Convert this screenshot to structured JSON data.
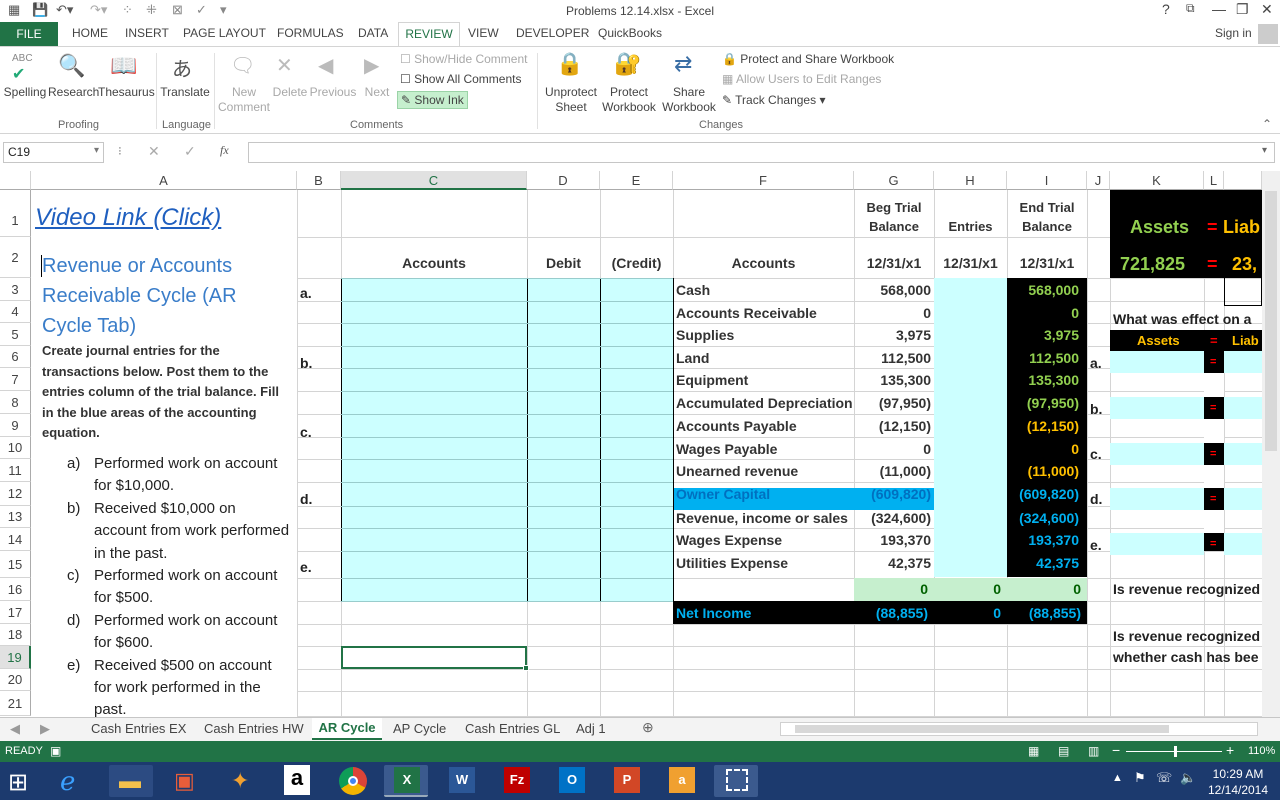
{
  "window": {
    "title": "Problems 12.14.xlsx - Excel",
    "help": "?",
    "sign_in": "Sign in"
  },
  "ribbon_tabs": [
    "FILE",
    "HOME",
    "INSERT",
    "PAGE LAYOUT",
    "FORMULAS",
    "DATA",
    "REVIEW",
    "VIEW",
    "DEVELOPER",
    "QuickBooks"
  ],
  "ribbon": {
    "spelling": "Spelling",
    "research": "Research",
    "thesaurus": "Thesaurus",
    "translate": "Translate",
    "new_comment": "New Comment",
    "delete": "Delete",
    "previous": "Previous",
    "next": "Next",
    "show_hide_comment": "Show/Hide Comment",
    "show_all_comments": "Show All Comments",
    "show_ink": "Show Ink",
    "unprotect_sheet": "Unprotect Sheet",
    "protect_workbook": "Protect Workbook",
    "share_workbook": "Share Workbook",
    "protect_share": "Protect and Share Workbook",
    "allow_users": "Allow Users to Edit Ranges",
    "track_changes": "Track Changes",
    "groups": {
      "proofing": "Proofing",
      "language": "Language",
      "comments": "Comments",
      "changes": "Changes"
    }
  },
  "formula_bar": {
    "name_box": "C19",
    "fx": "fx",
    "value": ""
  },
  "columns": [
    "A",
    "B",
    "C",
    "D",
    "E",
    "F",
    "G",
    "H",
    "I",
    "J",
    "K",
    "L"
  ],
  "rows": [
    "1",
    "2",
    "3",
    "4",
    "5",
    "6",
    "7",
    "8",
    "9",
    "10",
    "11",
    "12",
    "13",
    "14",
    "15",
    "16",
    "17",
    "18",
    "19",
    "20",
    "21"
  ],
  "sheet": {
    "video_link": "Video Link (Click)",
    "cycle_title": "Revenue or Accounts Receivable Cycle (AR Cycle Tab)",
    "instructions": "Create journal entries for the transactions below. Post them to the entries column of the trial balance. Fill in the blue areas of the accounting equation.",
    "transactions": [
      {
        "mark": "a)",
        "text": "Performed work on account for $10,000."
      },
      {
        "mark": "b)",
        "text": "Received $10,000 on account from work performed in the past."
      },
      {
        "mark": "c)",
        "text": "Performed work on account for $500."
      },
      {
        "mark": "d)",
        "text": "Performed work on account for $600."
      },
      {
        "mark": "e)",
        "text": "Received $500 on account for work performed in the past."
      }
    ],
    "journal_headers": {
      "accounts": "Accounts",
      "debit": "Debit",
      "credit": "(Credit)"
    },
    "journal_letters": [
      "a.",
      "b.",
      "c.",
      "d.",
      "e."
    ],
    "tb_headers": {
      "accounts": "Accounts",
      "beg": "Beg Trial Balance",
      "entries": "Entries",
      "end": "End Trial Balance",
      "date": "12/31/x1"
    },
    "tb_rows": [
      {
        "account": "Cash",
        "beg": "568,000",
        "end": "568,000"
      },
      {
        "account": "Accounts Receivable",
        "beg": "0",
        "end": "0"
      },
      {
        "account": "Supplies",
        "beg": "3,975",
        "end": "3,975"
      },
      {
        "account": "Land",
        "beg": "112,500",
        "end": "112,500"
      },
      {
        "account": "Equipment",
        "beg": "135,300",
        "end": "135,300"
      },
      {
        "account": "Accumulated Depreciation",
        "beg": "(97,950)",
        "end": "(97,950)"
      },
      {
        "account": "Accounts Payable",
        "beg": "(12,150)",
        "end": "(12,150)"
      },
      {
        "account": "Wages Payable",
        "beg": "0",
        "end": "0"
      },
      {
        "account": "Unearned revenue",
        "beg": "(11,000)",
        "end": "(11,000)"
      },
      {
        "account": "Owner Capital",
        "beg": "(609,820)",
        "end": "(609,820)"
      },
      {
        "account": "Revenue, income or sales",
        "beg": "(324,600)",
        "end": "(324,600)"
      },
      {
        "account": "Wages Expense",
        "beg": "193,370",
        "end": "193,370"
      },
      {
        "account": "Utilities Expense",
        "beg": "42,375",
        "end": "42,375"
      }
    ],
    "totals": {
      "beg": "0",
      "entries": "0",
      "end": "0"
    },
    "net_income": {
      "label": "Net Income",
      "beg": "(88,855)",
      "entries": "0",
      "end": "(88,855)"
    },
    "equation": {
      "assets": "Assets",
      "eq": "=",
      "liab": "Liab",
      "assets_value": "721,825",
      "liab_value": "23,"
    },
    "question1": "What was effect on a",
    "eq_letters": [
      "a.",
      "b.",
      "c.",
      "d.",
      "e."
    ],
    "question2": "Is revenue recognized",
    "question3a": "Is revenue recognized",
    "question3b": "whether cash has bee"
  },
  "sheet_tabs": [
    "Cash Entries EX",
    "Cash Entries HW",
    "AR Cycle",
    "AP Cycle",
    "Cash Entries GL",
    "Adj 1"
  ],
  "status": {
    "mode": "READY",
    "zoom": "110%"
  },
  "clock": {
    "time": "10:29 AM",
    "date": "12/14/2014"
  },
  "colors": {
    "excel_green": "#217346",
    "cyan": "#ccffff",
    "highlight_blue": "#00b0f0",
    "green_text": "#92d050",
    "orange_text": "#ffc000"
  }
}
